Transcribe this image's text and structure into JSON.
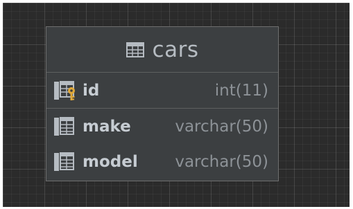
{
  "table": {
    "name": "cars",
    "icon": "table-icon",
    "primary_key": [
      {
        "name": "id",
        "type": "int(11)",
        "icon": "primary-key-column-icon"
      }
    ],
    "columns": [
      {
        "name": "make",
        "type": "varchar(50)",
        "icon": "column-icon"
      },
      {
        "name": "model",
        "type": "varchar(50)",
        "icon": "column-icon"
      }
    ]
  },
  "colors": {
    "canvas": "#2b2b2b",
    "node": "#3c3f41",
    "key": "#e0a93b"
  }
}
